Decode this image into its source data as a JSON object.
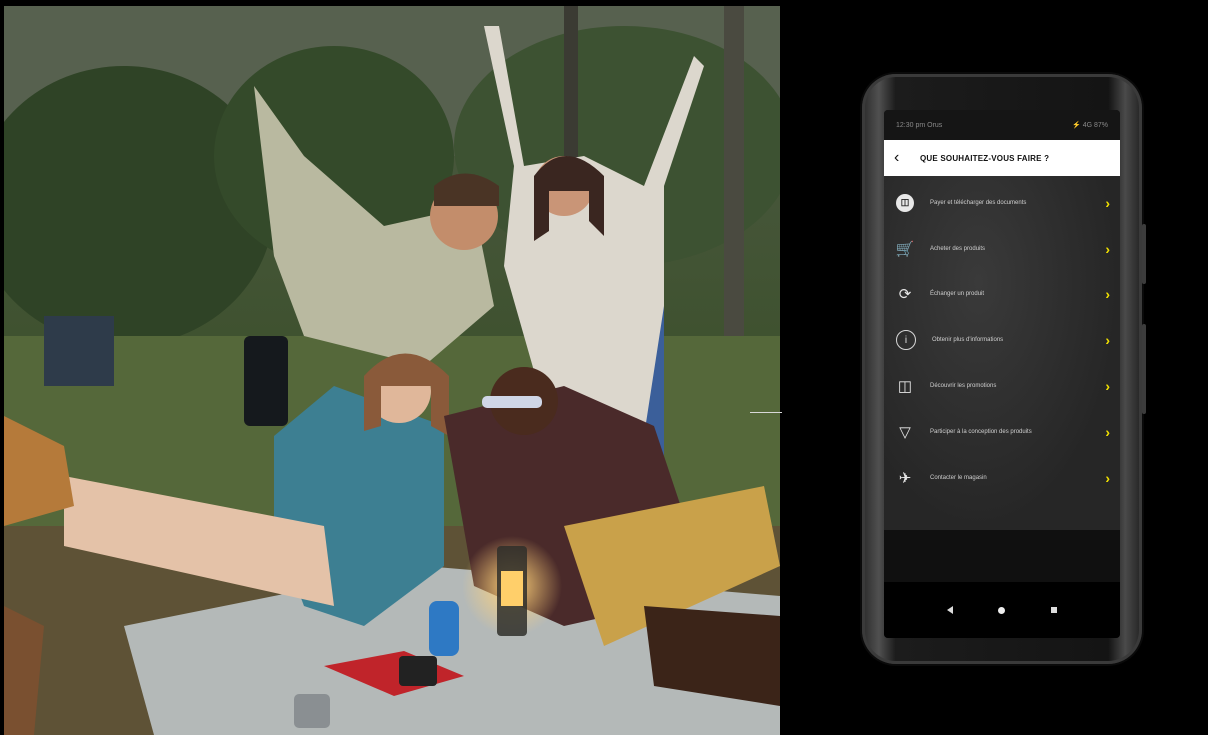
{
  "phone": {
    "status_left": "12:30 pm Orus",
    "status_right": "⚡ 4G 87%",
    "header_title": "QUE SOUHAITEZ-VOUS FAIRE ?",
    "menu": [
      {
        "icon": "scan-icon",
        "label": "Payer et télécharger des documents"
      },
      {
        "icon": "cart-icon",
        "label": "Acheter des produits"
      },
      {
        "icon": "tag-icon",
        "label": "Échanger un produit"
      },
      {
        "icon": "info-icon",
        "label": "Obtenir plus d'informations"
      },
      {
        "icon": "voucher-icon",
        "label": "Découvrir les promotions"
      },
      {
        "icon": "bulb-icon",
        "label": "Participer à la conception des produits"
      },
      {
        "icon": "support-icon",
        "label": "Contacter le magasin"
      }
    ],
    "accent_color": "#f2e200"
  }
}
